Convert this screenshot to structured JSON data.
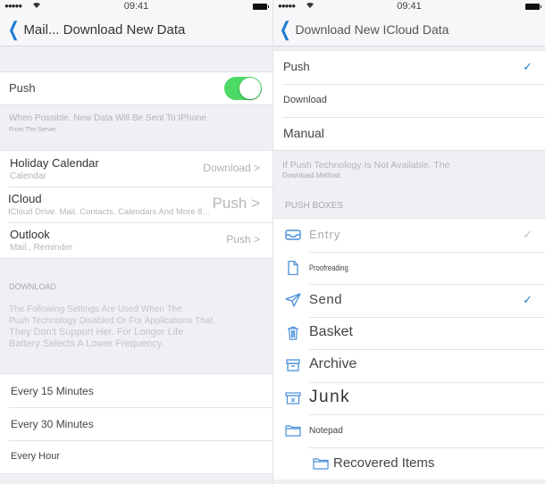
{
  "left_screen": {
    "status_bar": {
      "signal": "●●●●●",
      "wifi_icon": "wifi-icon",
      "time": "09:41",
      "battery_icon": "battery-icon"
    },
    "nav": {
      "back_icon": "chevron-left-icon",
      "title": "Mail... Download New Data"
    },
    "push": {
      "label": "Push",
      "toggle_on": true,
      "accent": "#4cd964"
    },
    "push_footnote": {
      "line1": "When Possible. New Data Will Be Sent To IPhone",
      "line2": "From The Server."
    },
    "accounts": [
      {
        "name": "Holiday Calendar",
        "subtitle": "Calendar",
        "value": "Download >"
      },
      {
        "name": "ICloud",
        "subtitle": "ICloud Drive. Mail. Contacts. Calendars And More 8...",
        "value": "Push >"
      },
      {
        "name": "Outlook",
        "subtitle": "Mail., Reminder",
        "value": "Push >"
      }
    ],
    "download_header": "DOWNLOAD",
    "download_footnote": [
      "The Following Settings Are Used When The",
      "Push Technology Disabled Or For Applications That",
      "They Don't Support Her. For Longer Life",
      "Battery Selects A Lower Frequency."
    ],
    "intervals": [
      {
        "label": "Every 15 Minutes"
      },
      {
        "label": "Every 30 Minutes"
      },
      {
        "label": "Every Hour"
      }
    ]
  },
  "right_screen": {
    "status_bar": {
      "signal": "●●●●●",
      "wifi_icon": "wifi-icon",
      "time": "09:41",
      "battery_icon": "battery-icon"
    },
    "nav": {
      "back_icon": "chevron-left-icon",
      "title": "Download New ICloud Data"
    },
    "methods": [
      {
        "label": "Push",
        "checked": true
      },
      {
        "label": "Download",
        "checked": false
      },
      {
        "label": "Manual",
        "checked": false
      }
    ],
    "methods_footnote": {
      "line1": "If Push Technology Is Not Available. The",
      "line2": "Download Method."
    },
    "push_boxes_header": "PUSH BOXES",
    "boxes": [
      {
        "label": "Entry",
        "icon": "inbox-icon",
        "checked": true,
        "check_style": "faded"
      },
      {
        "label": "Proofreading",
        "icon": "draft-document-icon",
        "checked": false
      },
      {
        "label": "Send",
        "icon": "paper-plane-icon",
        "checked": true,
        "check_style": "accent"
      },
      {
        "label": "Basket",
        "icon": "trash-icon",
        "checked": false
      },
      {
        "label": "Archive",
        "icon": "archive-box-icon",
        "checked": false
      },
      {
        "label": "Junk",
        "icon": "junk-box-icon",
        "checked": false
      },
      {
        "label": "Notepad",
        "icon": "folder-icon",
        "checked": false
      },
      {
        "label": "Recovered Items",
        "icon": "folder-icon",
        "checked": false
      }
    ],
    "check_glyph": "✓",
    "accent": "#1c7cd5"
  }
}
